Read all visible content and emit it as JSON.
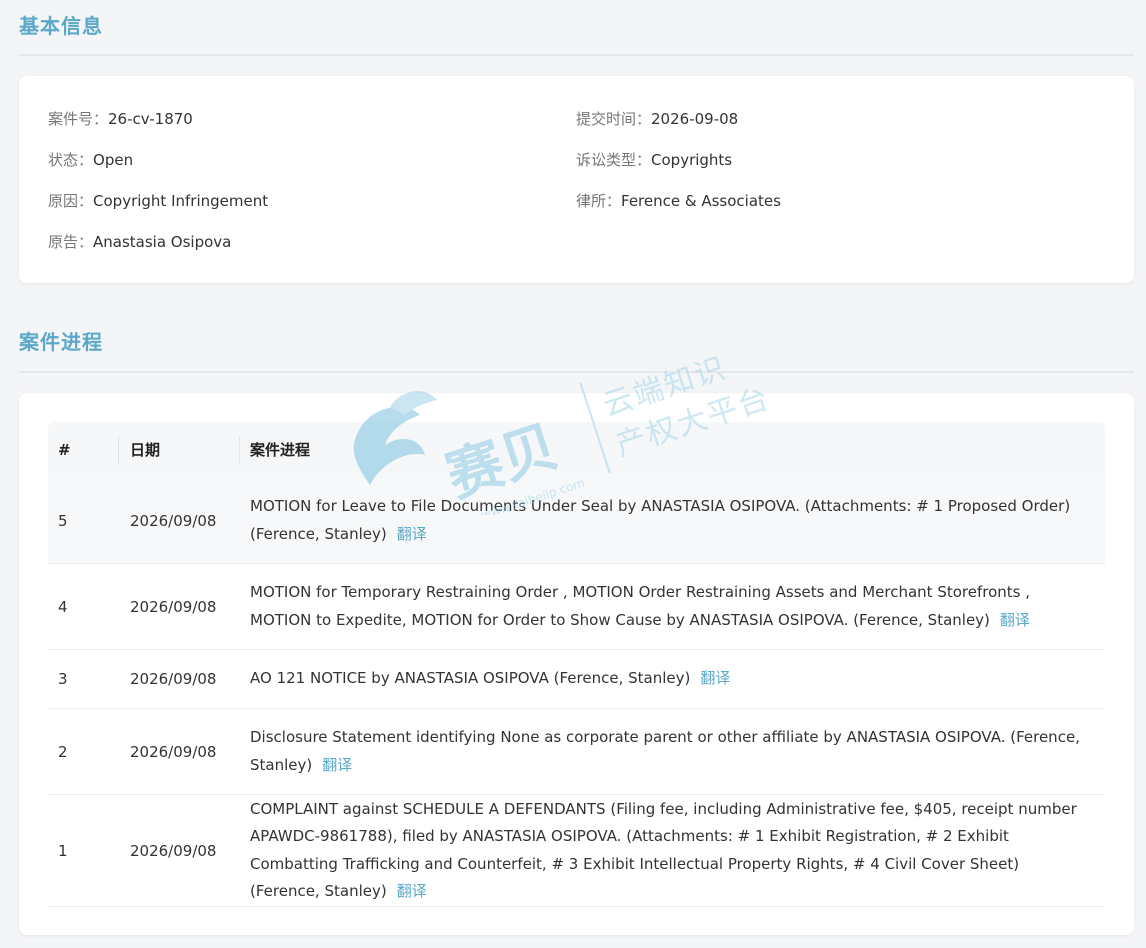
{
  "basic_info": {
    "title": "基本信息",
    "case_no_label": "案件号：",
    "case_no": "26-cv-1870",
    "submit_time_label": "提交时间：",
    "submit_time": "2026-09-08",
    "status_label": "状态：",
    "status": "Open",
    "litigation_type_label": "诉讼类型：",
    "litigation_type": "Copyrights",
    "cause_label": "原因：",
    "cause": "Copyright Infringement",
    "law_firm_label": "律所：",
    "law_firm": "Ference & Associates",
    "plaintiff_label": "原告：",
    "plaintiff": "Anastasia Osipova"
  },
  "progress": {
    "title": "案件进程",
    "headers": {
      "num": "#",
      "date": "日期",
      "progress": "案件进程"
    },
    "translate_label": "翻译",
    "rows": [
      {
        "num": "5",
        "date": "2026/09/08",
        "text": "MOTION for Leave to File Documents Under Seal by ANASTASIA OSIPOVA. (Attachments: # 1 Proposed Order) (Ference, Stanley)"
      },
      {
        "num": "4",
        "date": "2026/09/08",
        "text": "MOTION for Temporary Restraining Order , MOTION Order Restraining Assets and Merchant Storefronts , MOTION to Expedite, MOTION for Order to Show Cause by ANASTASIA OSIPOVA. (Ference, Stanley)"
      },
      {
        "num": "3",
        "date": "2026/09/08",
        "text": "AO 121 NOTICE by ANASTASIA OSIPOVA (Ference, Stanley)"
      },
      {
        "num": "2",
        "date": "2026/09/08",
        "text": "Disclosure Statement identifying None as corporate parent or other affiliate by ANASTASIA OSIPOVA. (Ference, Stanley)"
      },
      {
        "num": "1",
        "date": "2026/09/08",
        "text": "COMPLAINT against SCHEDULE A DEFENDANTS (Filing fee, including Administrative fee, $405, receipt number APAWDC-9861788), filed by ANASTASIA OSIPOVA. (Attachments: # 1 Exhibit Registration, # 2 Exhibit Combatting Trafficking and Counterfeit, # 3 Exhibit Intellectual Property Rights, # 4 Civil Cover Sheet) (Ference, Stanley)"
      }
    ]
  },
  "watermark": {
    "brand": "赛贝",
    "url": "www.saibeiip.com",
    "slogan_line1": "云端知识",
    "slogan_line2": "产权大平台"
  },
  "colors": {
    "accent": "#5ba8c8",
    "background": "#f4f5f7"
  }
}
